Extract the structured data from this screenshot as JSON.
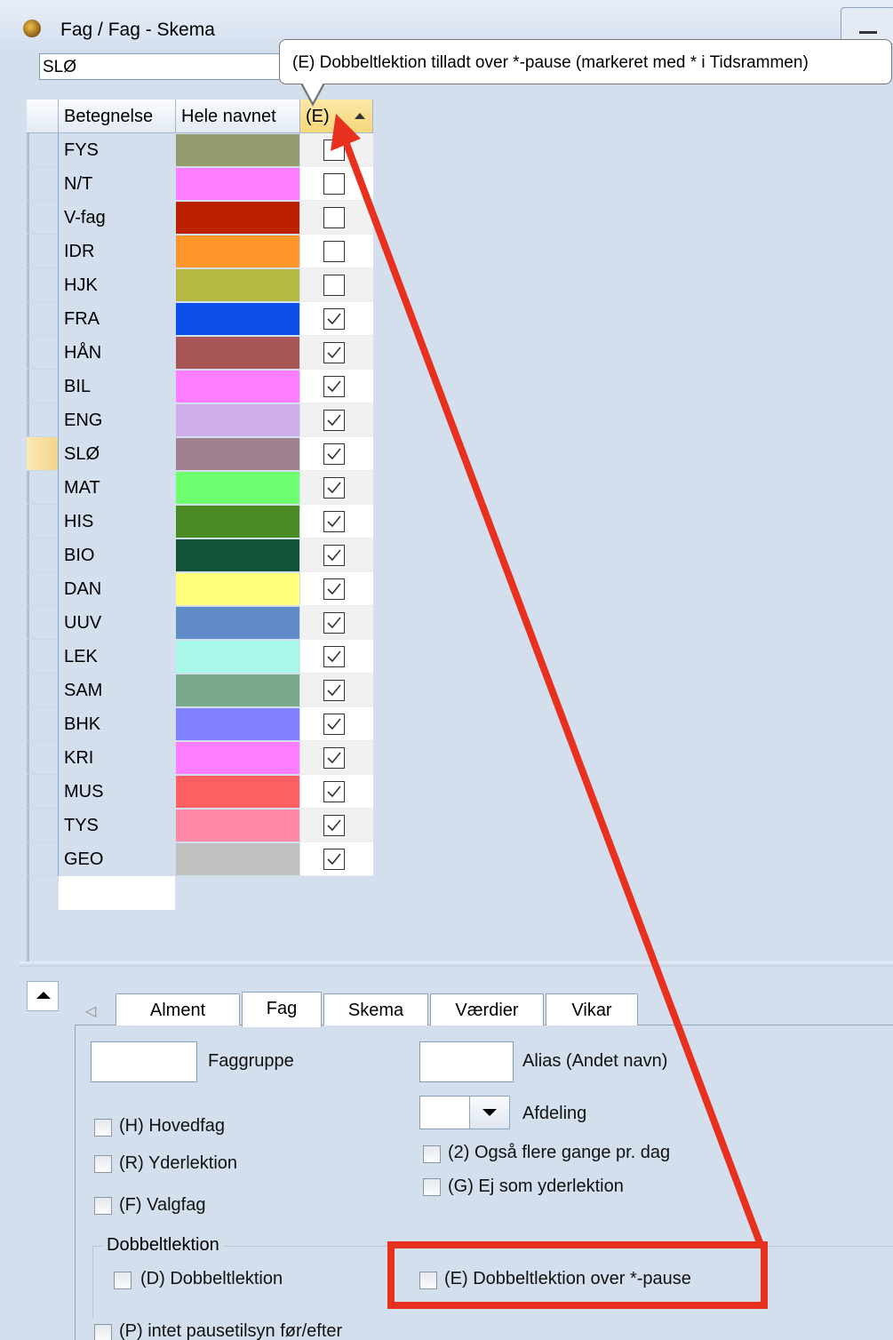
{
  "window": {
    "title": "Fag / Fag - Skema",
    "icon": "clock-icon"
  },
  "selector": {
    "value": "SLØ"
  },
  "tooltip": {
    "text": "(E) Dobbeltlektion tilladt over *-pause (markeret med * i Tidsrammen)"
  },
  "grid": {
    "columns": [
      "Betegnelse",
      "Hele navnet",
      "(E)"
    ],
    "sort_column": "(E)",
    "current_row": "SLØ",
    "rows": [
      {
        "name": "FYS",
        "color": "#939b6f",
        "checked": false
      },
      {
        "name": "N/T",
        "color": "#ff7dff",
        "checked": false
      },
      {
        "name": "V-fag",
        "color": "#bb2000",
        "checked": false
      },
      {
        "name": "IDR",
        "color": "#ff962b",
        "checked": false
      },
      {
        "name": "HJK",
        "color": "#b5b942",
        "checked": false
      },
      {
        "name": "FRA",
        "color": "#0c4fe9",
        "checked": true
      },
      {
        "name": "HÅN",
        "color": "#a85556",
        "checked": true
      },
      {
        "name": "BIL",
        "color": "#ff7dff",
        "checked": true
      },
      {
        "name": "ENG",
        "color": "#cdaee8",
        "checked": true
      },
      {
        "name": "SLØ",
        "color": "#a08091",
        "checked": true
      },
      {
        "name": "MAT",
        "color": "#6eff6e",
        "checked": true
      },
      {
        "name": "HIS",
        "color": "#4a8b24",
        "checked": true
      },
      {
        "name": "BIO",
        "color": "#125238",
        "checked": true
      },
      {
        "name": "DAN",
        "color": "#ffff7a",
        "checked": true
      },
      {
        "name": "UUV",
        "color": "#5f8bc9",
        "checked": true
      },
      {
        "name": "LEK",
        "color": "#a8f9ea",
        "checked": true
      },
      {
        "name": "SAM",
        "color": "#7aa88c",
        "checked": true
      },
      {
        "name": "BHK",
        "color": "#8181ff",
        "checked": true
      },
      {
        "name": "KRI",
        "color": "#ff7dff",
        "checked": true
      },
      {
        "name": "MUS",
        "color": "#ff6163",
        "checked": true
      },
      {
        "name": "TYS",
        "color": "#ff8aa7",
        "checked": true
      },
      {
        "name": "GEO",
        "color": "#c1c1c1",
        "checked": true
      }
    ]
  },
  "tabs": [
    "Alment",
    "Fag",
    "Skema",
    "Værdier",
    "Vikar"
  ],
  "active_tab": "Fag",
  "form": {
    "faggruppe_label": "Faggruppe",
    "alias_label": "Alias (Andet navn)",
    "afdeling_label": "Afdeling",
    "hovedfag_label": "(H) Hovedfag",
    "yderlektion_label": "(R) Yderlektion",
    "valgfag_label": "(F) Valgfag",
    "flere_gange_label": "(2) Også flere gange pr. dag",
    "ej_yder_label": "(G) Ej som yderlektion",
    "dobbelt_group_label": "Dobbeltlektion",
    "dobbelt_label": "(D) Dobbeltlektion",
    "dobbelt_pause_label": "(E) Dobbeltlektion over *-pause",
    "pausetilsyn_label": "(P) intet pausetilsyn før/efter"
  },
  "annotation": {
    "color": "#e8301f"
  }
}
